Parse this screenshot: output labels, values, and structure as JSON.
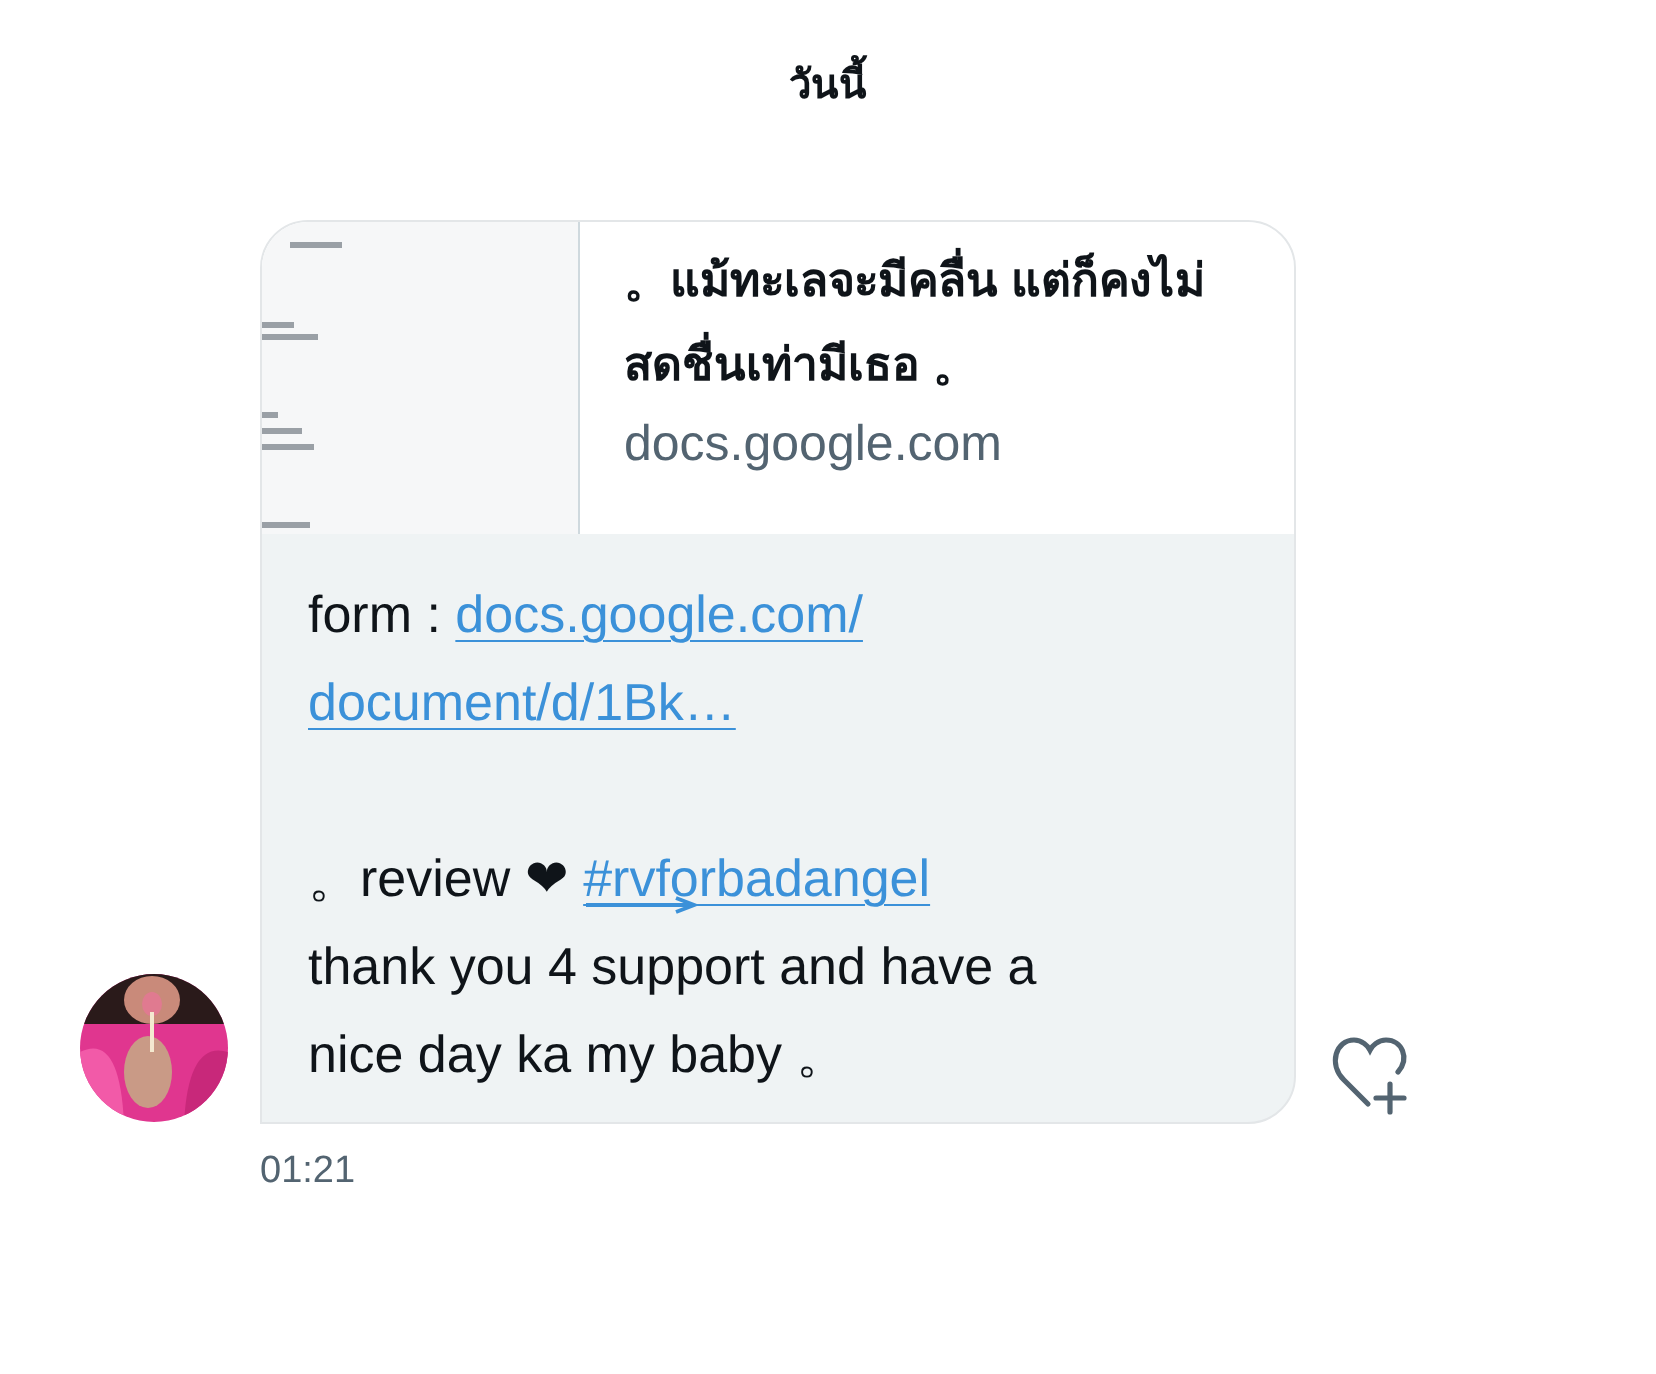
{
  "day_label": "วันนี้",
  "link_card": {
    "title": "。แม้ทะเลจะมีคลื่น แต่ก็คงไม่สดชื่นเท่ามีเธอ 。",
    "domain": "docs.google.com"
  },
  "message": {
    "lines": [
      {
        "kind": "mixed",
        "parts": [
          {
            "kind": "text",
            "text": "form : "
          },
          {
            "kind": "link",
            "text": "docs.google.com/"
          }
        ]
      },
      {
        "kind": "mixed",
        "parts": [
          {
            "kind": "link",
            "text": "document/d/1Bk…"
          }
        ]
      },
      {
        "kind": "blank"
      },
      {
        "kind": "mixed",
        "parts": [
          {
            "kind": "text",
            "text": "。review ❤ "
          },
          {
            "kind": "hashtag",
            "text": "#rvforbadangel"
          }
        ]
      },
      {
        "kind": "mixed",
        "parts": [
          {
            "kind": "text",
            "text": "thank you 4 support and have a"
          }
        ]
      },
      {
        "kind": "mixed",
        "parts": [
          {
            "kind": "text",
            "text": "nice day ka my baby 。"
          }
        ]
      }
    ]
  },
  "timestamp": "01:21"
}
